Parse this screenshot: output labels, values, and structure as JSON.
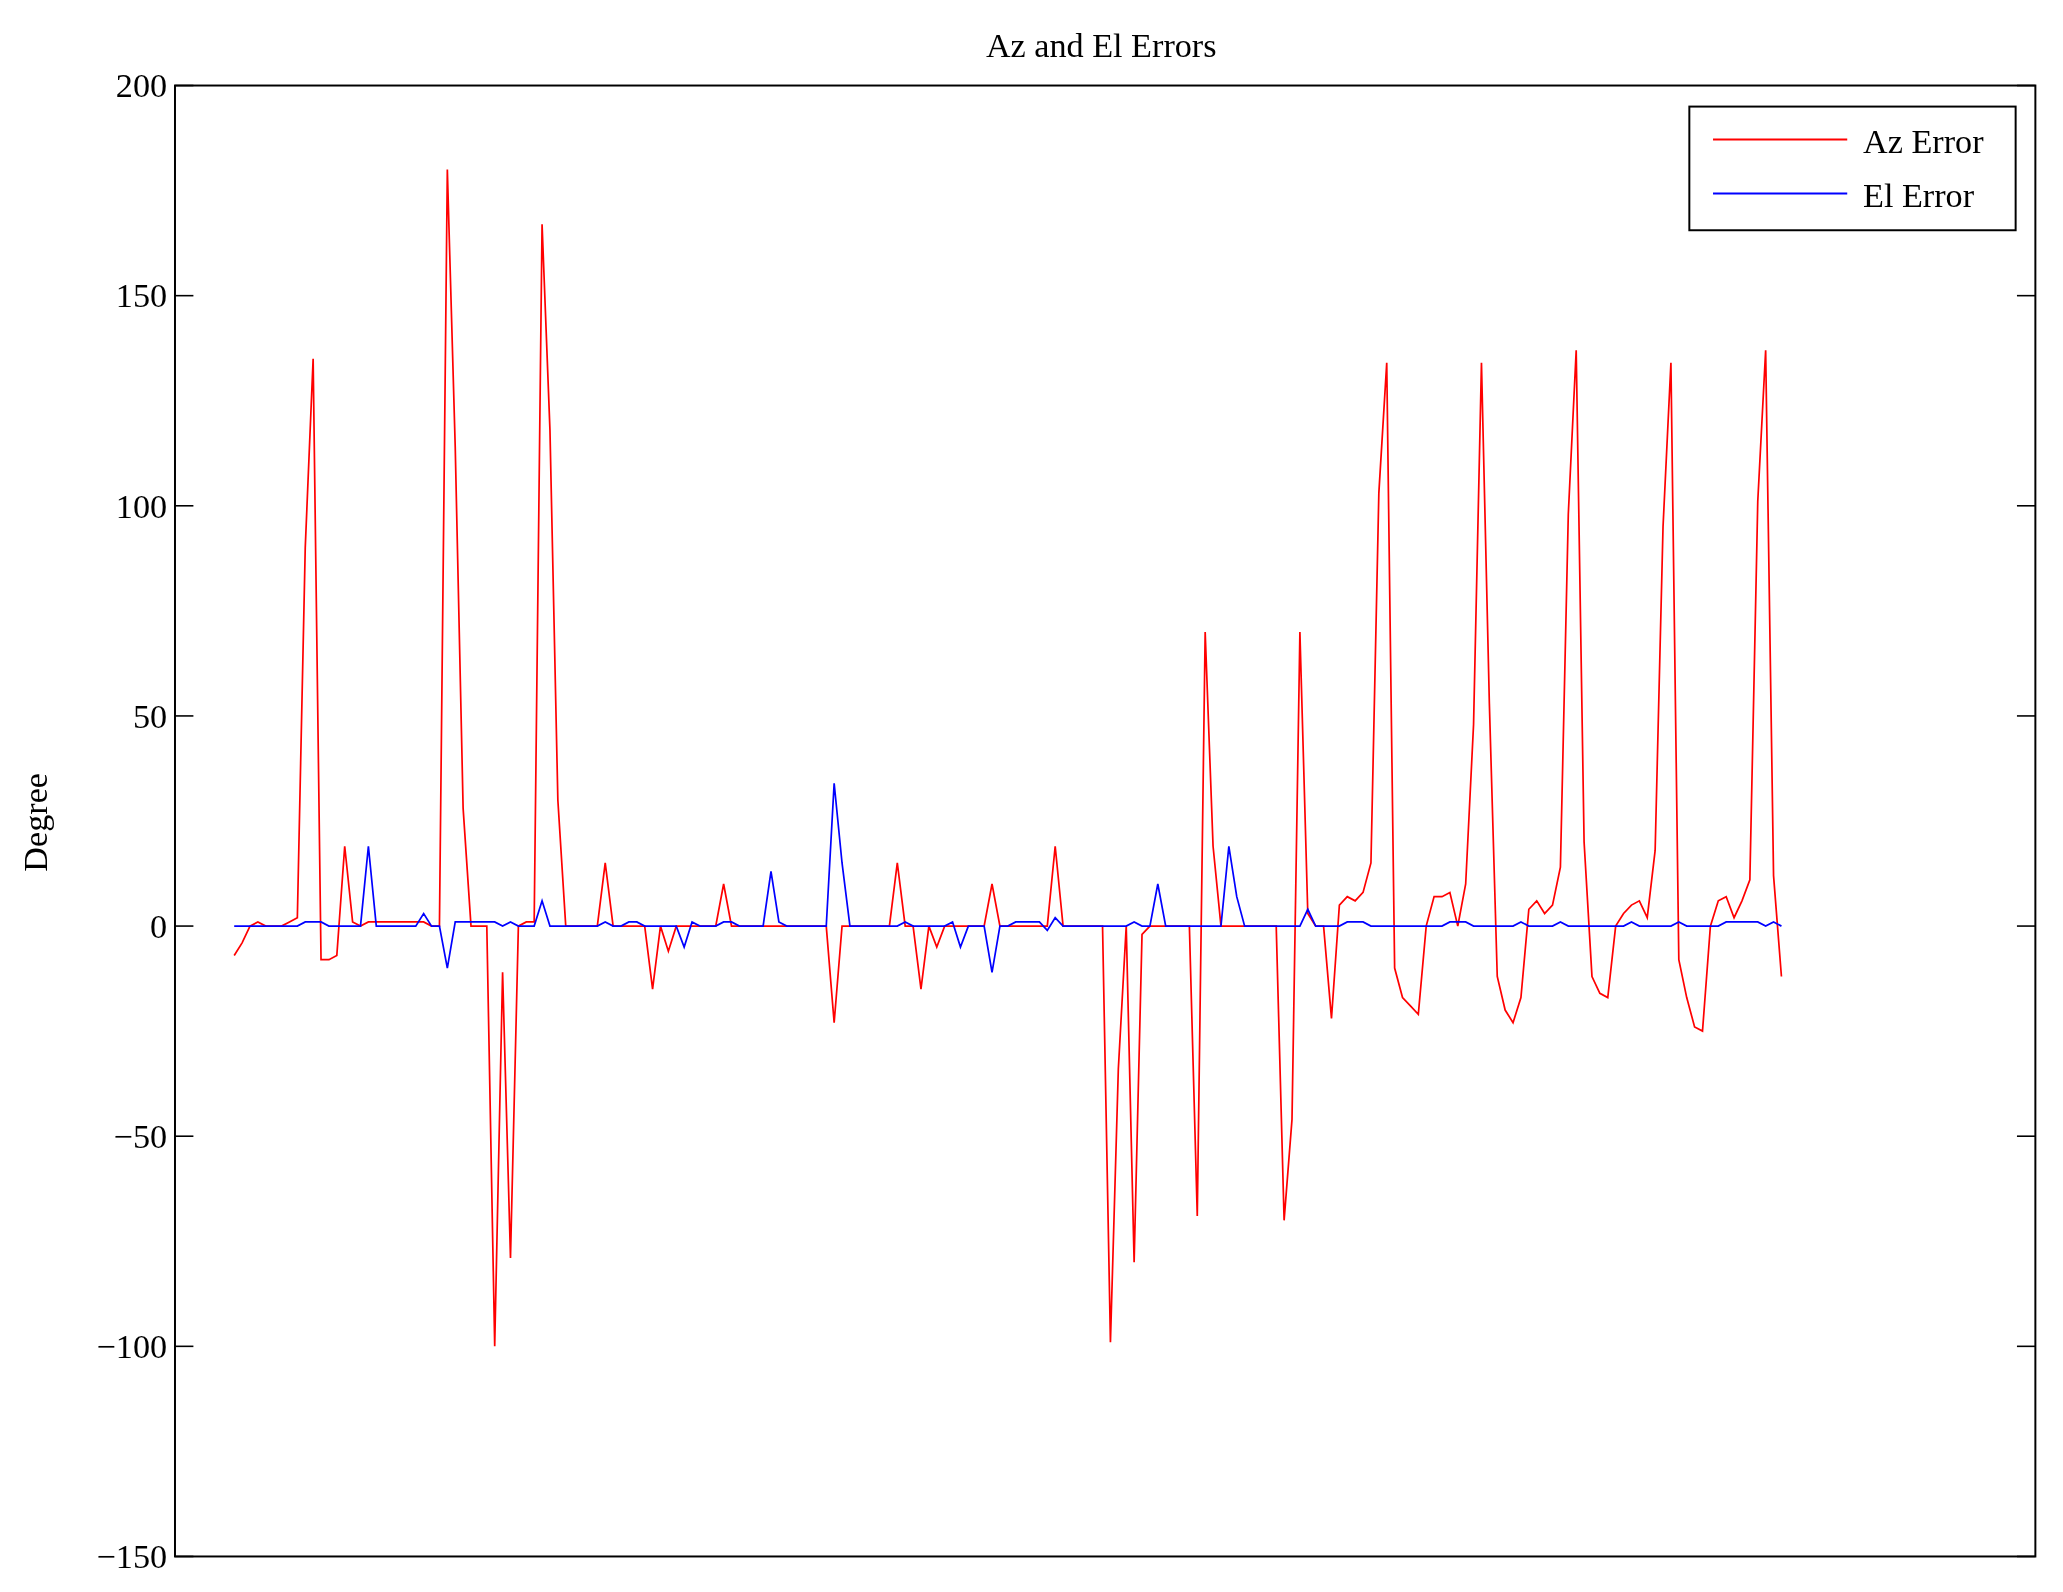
{
  "figure": {
    "chart_data": {
      "type": "line",
      "title": "Az and El Errors",
      "ylabel": "Degree",
      "legend": "upper right",
      "ylim": [
        -150,
        200
      ],
      "yticks": [
        {
          "value": -150,
          "label": "−150"
        },
        {
          "value": -100,
          "label": "−100"
        },
        {
          "value": -50,
          "label": "−50"
        },
        {
          "value": 0,
          "label": "0"
        },
        {
          "value": 50,
          "label": "50"
        },
        {
          "value": 100,
          "label": "100"
        },
        {
          "value": 150,
          "label": "150"
        },
        {
          "value": 200,
          "label": "200"
        }
      ],
      "categories": [
        null,
        null,
        null,
        null,
        null,
        null,
        null,
        null,
        null,
        null,
        null,
        null,
        null,
        null,
        null,
        null,
        null,
        null,
        null,
        null,
        null,
        null,
        null,
        null,
        null,
        null,
        null,
        null,
        null,
        null,
        null,
        null,
        null,
        null,
        null,
        null,
        null,
        null,
        null,
        null,
        null,
        null,
        null,
        null,
        null,
        null,
        null,
        null,
        null,
        null,
        null,
        null,
        null,
        null,
        null,
        null,
        null,
        null,
        null,
        null,
        null,
        null,
        null,
        null,
        null,
        null,
        null,
        null,
        null,
        null,
        null,
        null,
        null,
        null,
        null,
        null,
        null,
        null,
        null,
        null,
        null,
        null,
        null,
        null,
        null,
        null,
        null,
        null,
        null,
        null,
        null,
        null,
        null,
        null,
        null,
        null,
        null,
        null,
        null,
        null,
        null,
        null,
        null,
        null,
        null,
        null,
        null,
        null,
        null,
        null,
        null,
        null,
        null,
        null,
        null,
        null,
        null,
        null,
        null,
        null,
        null,
        null,
        null,
        null,
        null,
        null,
        null,
        null,
        null,
        null,
        null,
        null,
        null,
        null,
        null,
        null,
        null,
        null,
        null,
        null,
        null,
        null,
        null,
        null,
        null,
        null,
        null,
        null,
        null,
        null,
        null,
        null,
        null,
        null,
        null,
        null,
        null,
        null,
        null,
        null,
        null,
        null,
        null,
        null,
        null,
        null,
        null,
        null,
        null,
        null,
        null,
        null,
        null,
        null,
        null,
        null,
        null,
        null,
        null,
        null,
        null,
        null,
        null,
        null,
        null,
        null,
        null,
        null,
        null,
        null,
        null,
        null,
        null,
        null,
        null,
        null,
        null
      ],
      "series": [
        {
          "name": "Az Error",
          "color": "#ff0000",
          "values": [
            -7,
            -4,
            0,
            1,
            0,
            0,
            0,
            1,
            2,
            90,
            135,
            -8,
            -8,
            -7,
            19,
            1,
            0,
            1,
            1,
            1,
            1,
            1,
            1,
            1,
            1,
            0,
            0,
            180,
            114,
            28,
            0,
            0,
            0,
            -100,
            -11,
            -79,
            0,
            1,
            1,
            167,
            118,
            30,
            0,
            0,
            0,
            0,
            0,
            15,
            0,
            0,
            0,
            0,
            0,
            -15,
            0,
            -6,
            0,
            0,
            0,
            0,
            0,
            0,
            10,
            0,
            0,
            0,
            0,
            0,
            0,
            0,
            0,
            0,
            0,
            0,
            0,
            0,
            -23,
            0,
            0,
            0,
            0,
            0,
            0,
            0,
            15,
            0,
            0,
            -15,
            0,
            -5,
            0,
            0,
            0,
            0,
            0,
            0,
            10,
            0,
            0,
            0,
            0,
            0,
            0,
            0,
            19,
            0,
            0,
            0,
            0,
            0,
            0,
            -99,
            -34,
            0,
            -80,
            -2,
            0,
            0,
            0,
            0,
            0,
            0,
            -69,
            70,
            19,
            0,
            0,
            0,
            0,
            0,
            0,
            0,
            0,
            -70,
            -46,
            70,
            3,
            0,
            0,
            -22,
            5,
            7,
            6,
            8,
            15,
            103,
            134,
            -10,
            -17,
            -19,
            -21,
            0,
            7,
            7,
            8,
            0,
            10,
            48,
            134,
            53,
            -12,
            -20,
            -23,
            -17,
            4,
            6,
            3,
            5,
            14,
            98,
            137,
            20,
            -12,
            -16,
            -17,
            0,
            3,
            5,
            6,
            2,
            18,
            95,
            134,
            -8,
            -17,
            -24,
            -25,
            0,
            6,
            7,
            2,
            6,
            11,
            101,
            137,
            12,
            -12
          ]
        },
        {
          "name": "El Error",
          "color": "#0000ff",
          "values": [
            0,
            0,
            0,
            0,
            0,
            0,
            0,
            0,
            0,
            1,
            1,
            1,
            0,
            0,
            0,
            0,
            0,
            19,
            0,
            0,
            0,
            0,
            0,
            0,
            3,
            0,
            0,
            -10,
            1,
            1,
            1,
            1,
            1,
            1,
            0,
            1,
            0,
            0,
            0,
            6,
            0,
            0,
            0,
            0,
            0,
            0,
            0,
            1,
            0,
            0,
            1,
            1,
            0,
            0,
            0,
            0,
            0,
            -5,
            1,
            0,
            0,
            0,
            1,
            1,
            0,
            0,
            0,
            0,
            13,
            1,
            0,
            0,
            0,
            0,
            0,
            0,
            34,
            15,
            0,
            0,
            0,
            0,
            0,
            0,
            0,
            1,
            0,
            0,
            0,
            0,
            0,
            1,
            -5,
            0,
            0,
            0,
            -11,
            0,
            0,
            1,
            1,
            1,
            1,
            -1,
            2,
            0,
            0,
            0,
            0,
            0,
            0,
            0,
            0,
            0,
            1,
            0,
            0,
            10,
            0,
            0,
            0,
            0,
            0,
            0,
            0,
            0,
            19,
            7,
            0,
            0,
            0,
            0,
            0,
            0,
            0,
            0,
            4,
            0,
            0,
            0,
            0,
            1,
            1,
            1,
            0,
            0,
            0,
            0,
            0,
            0,
            0,
            0,
            0,
            0,
            1,
            1,
            1,
            0,
            0,
            0,
            0,
            0,
            0,
            1,
            0,
            0,
            0,
            0,
            1,
            0,
            0,
            0,
            0,
            0,
            0,
            0,
            0,
            1,
            0,
            0,
            0,
            0,
            0,
            1,
            0,
            0,
            0,
            0,
            0,
            1,
            1,
            1,
            1,
            1,
            0,
            1,
            0
          ]
        }
      ]
    }
  }
}
